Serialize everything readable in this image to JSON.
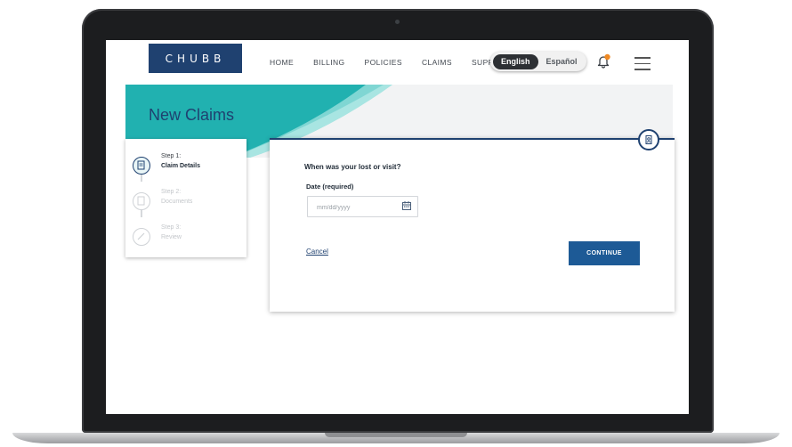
{
  "brand": {
    "logo_text": "CHUBB"
  },
  "nav": {
    "items": [
      {
        "label": "HOME"
      },
      {
        "label": "BILLING"
      },
      {
        "label": "POLICIES"
      },
      {
        "label": "CLAIMS"
      },
      {
        "label": "SUPPORT"
      }
    ]
  },
  "language": {
    "active": "English",
    "inactive": "Español"
  },
  "icons": {
    "bell": "bell-icon",
    "menu": "hamburger-menu-icon",
    "calendar": "calendar-icon",
    "badge": "id-badge-icon"
  },
  "page": {
    "title": "New Claims"
  },
  "steps": [
    {
      "number": "Step 1:",
      "name": "Claim Details",
      "state": "current"
    },
    {
      "number": "Step 2:",
      "name": "Documents",
      "state": "pending"
    },
    {
      "number": "Step 3:",
      "name": "Review",
      "state": "pending"
    }
  ],
  "form": {
    "question": "When was your lost or visit?",
    "date_label": "Date (required)",
    "date_placeholder": "mm/dd/yyyy",
    "cancel_label": "Cancel",
    "continue_label": "CONTINUE"
  },
  "colors": {
    "brand_navy": "#1f4170",
    "teal": "#21b1b0",
    "button_blue": "#1d5a96",
    "notification_orange": "#f08a24"
  }
}
